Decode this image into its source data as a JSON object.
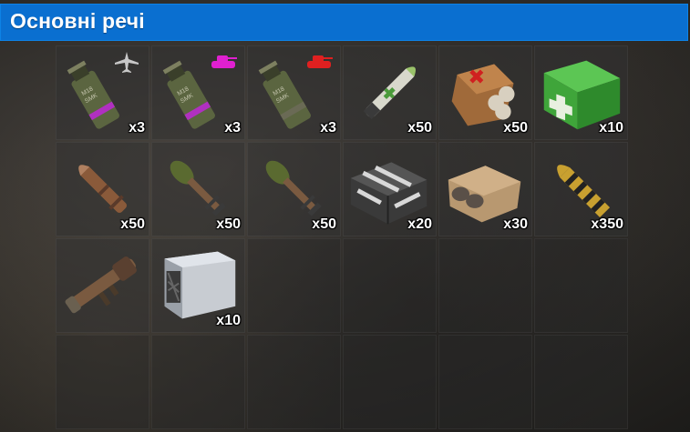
{
  "header": {
    "title": "Основні речі"
  },
  "slots": [
    {
      "name": "smoke-grenade-aircraft",
      "icon": "smoke-grenade-icon",
      "badge": "aircraft-icon",
      "qty": "x3"
    },
    {
      "name": "smoke-grenade-pink-tank",
      "icon": "smoke-grenade-icon",
      "badge": "tank-icon",
      "qty": "x3"
    },
    {
      "name": "smoke-grenade-red-tank",
      "icon": "smoke-grenade-icon",
      "badge": "tank-icon",
      "qty": "x3"
    },
    {
      "name": "medical-rocket",
      "icon": "rocket-icon",
      "qty": "x50"
    },
    {
      "name": "medical-canister-pack",
      "icon": "canister-pack-icon",
      "qty": "x50"
    },
    {
      "name": "medkit-box",
      "icon": "medkit-icon",
      "qty": "x10"
    },
    {
      "name": "rocket-copper",
      "icon": "rocket-icon",
      "qty": "x50"
    },
    {
      "name": "rocket-green-tip",
      "icon": "rocket-icon",
      "qty": "x50"
    },
    {
      "name": "rocket-green-tip-2",
      "icon": "rocket-icon",
      "qty": "x50"
    },
    {
      "name": "camo-explosive-pack",
      "icon": "explosive-pack-icon",
      "qty": "x20"
    },
    {
      "name": "taped-explosive-pack",
      "icon": "explosive-pack-icon",
      "qty": "x30"
    },
    {
      "name": "striped-ammo",
      "icon": "ammo-icon",
      "qty": "x350"
    },
    {
      "name": "rocket-launcher",
      "icon": "launcher-icon",
      "qty": ""
    },
    {
      "name": "mining-rig",
      "icon": "mining-rig-icon",
      "qty": "x10"
    }
  ],
  "colors": {
    "header_bg": "#0a6fd0",
    "badge_pink": "#e020d0",
    "badge_red": "#e02020",
    "grenade_stripe": "#b030c0",
    "medkit_green": "#3fa53a"
  }
}
